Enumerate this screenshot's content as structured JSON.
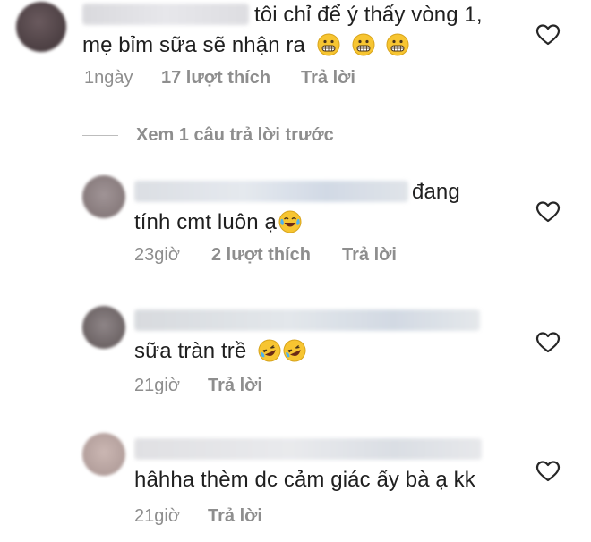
{
  "comments": [
    {
      "text_line1": "tôi chỉ để ý thấy vòng 1,",
      "text_line2": "mẹ bỉm sữa sẽ nhận ra",
      "time": "1ngày",
      "likes": "17 lượt thích",
      "reply": "Trả lời",
      "emoji": "grimacing-face-emoji"
    },
    {
      "text_line1": "đang",
      "text_line2": "tính cmt luôn ạ",
      "time": "23giờ",
      "likes": "2 lượt thích",
      "reply": "Trả lời",
      "emoji": "tears-of-joy-emoji"
    },
    {
      "text_line1": "sữa tràn trề",
      "time": "21giờ",
      "reply": "Trả lời",
      "emoji": "rolling-laughing-emoji"
    },
    {
      "text_line1": "hâhha thèm dc cảm giác ấy bà ạ kk",
      "time": "21giờ",
      "reply": "Trả lời"
    }
  ],
  "view_replies": "Xem 1 câu trả lời trước",
  "colors": {
    "text": "#1f1f1f",
    "meta": "#8e8e8e",
    "heart": "#262626"
  }
}
